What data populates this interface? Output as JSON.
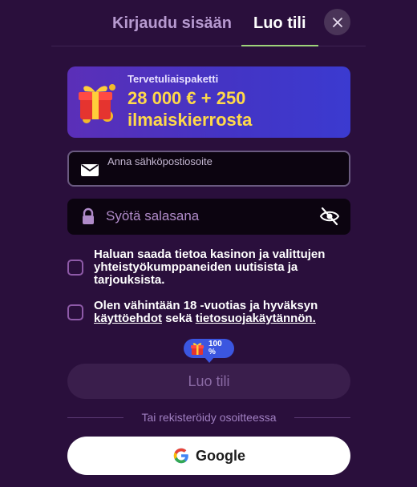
{
  "tabs": {
    "login_label": "Kirjaudu sisään",
    "register_label": "Luo tili",
    "active": "register"
  },
  "close": {
    "icon": "close-icon"
  },
  "banner": {
    "subtitle": "Tervetuliaispaketti",
    "line1": "28 000 € + 250",
    "line2": "ilmaiskierrosta",
    "icon": "gift-box-icon"
  },
  "form": {
    "email": {
      "label": "Anna sähköpostiosoite",
      "value": "",
      "icon": "envelope-icon"
    },
    "password": {
      "placeholder": "Syötä salasana",
      "value": "",
      "icon": "lock-icon",
      "toggle_icon": "eye-off-icon"
    },
    "newsletter": {
      "text": "Haluan saada tietoa kasinon ja valittujen yhteistyökumppaneiden uutisista ja tarjouksista.",
      "checked": false
    },
    "terms": {
      "text_before": "Olen vähintään 18 -vuotias ja hyväksyn ",
      "terms_link": "käyttöehdot",
      "text_middle": " sekä ",
      "privacy_link": "tietosuojakäytännön.",
      "checked": false
    }
  },
  "bonus_badge": {
    "text": "100 %",
    "icon": "gift-icon"
  },
  "submit": {
    "label": "Luo tili",
    "enabled": false
  },
  "divider": {
    "text": "Tai rekisteröidy osoitteessa"
  },
  "google": {
    "label": "Google",
    "icon": "google-g-icon"
  },
  "colors": {
    "background": "#2a0f3c",
    "accent_underline": "#9ed37a",
    "banner_amount": "#ffd94a",
    "pill": "#3b56e0"
  }
}
